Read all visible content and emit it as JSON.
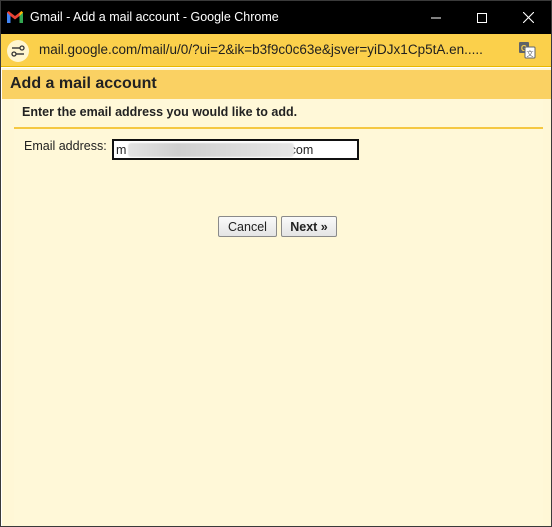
{
  "window": {
    "title": "Gmail - Add a mail account - Google Chrome",
    "controls": {
      "minimize_icon": "minimize-icon",
      "maximize_icon": "maximize-icon",
      "close_icon": "close-icon"
    }
  },
  "addressbar": {
    "url": "mail.google.com/mail/u/0/?ui=2&ik=b3f9c0c63e&jsver=yiDJx1Cp5tA.en.....",
    "site_info_icon": "site-info-icon",
    "translate_icon": "translate-icon"
  },
  "dialog": {
    "title": "Add a mail account",
    "instruction": "Enter the email address you would like to add.",
    "email_label": "Email address:",
    "email_value": "m                                              .com",
    "buttons": {
      "cancel": "Cancel",
      "next": "Next »"
    }
  },
  "colors": {
    "titlebar": "#000000",
    "addressbar": "#fbd04b",
    "dialog_header": "#fad163",
    "dialog_body": "#fff8d8",
    "divider": "#f5c842"
  }
}
